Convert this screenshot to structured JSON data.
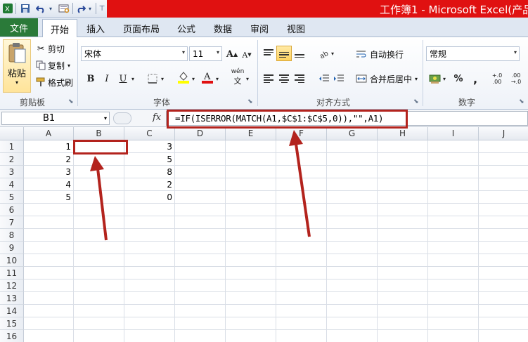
{
  "window": {
    "title": "工作簿1 - Microsoft Excel(产品",
    "quick_access": [
      "excel-logo-icon",
      "save-icon",
      "undo-icon",
      "print-preview-icon",
      "redo-icon",
      "customize-icon"
    ]
  },
  "tabs": {
    "file": "文件",
    "items": [
      "开始",
      "插入",
      "页面布局",
      "公式",
      "数据",
      "审阅",
      "视图"
    ],
    "active": "开始"
  },
  "ribbon": {
    "clipboard": {
      "paste": "粘贴",
      "cut": "剪切",
      "copy": "复制",
      "format_painter": "格式刷",
      "label": "剪贴板"
    },
    "font": {
      "name": "宋体",
      "size": "11",
      "bold": "B",
      "italic": "I",
      "underline": "U",
      "grow": "A",
      "shrink": "A",
      "wen": "wén",
      "label": "字体"
    },
    "alignment": {
      "wrap": "自动换行",
      "merge": "合并后居中",
      "label": "对齐方式"
    },
    "number": {
      "format": "常规",
      "percent": "%",
      "comma": ",",
      "inc": "+.0 .00",
      "dec": ".00 →.0",
      "label": "数字"
    }
  },
  "formula_bar": {
    "name_box": "B1",
    "fx": "fx",
    "formula": "=IF(ISERROR(MATCH(A1,$C$1:$C$5,0)),\"\",A1)"
  },
  "sheet": {
    "columns": [
      "A",
      "B",
      "C",
      "D",
      "E",
      "F",
      "G",
      "H",
      "I",
      "J"
    ],
    "rows": [
      "1",
      "2",
      "3",
      "4",
      "5",
      "6",
      "7",
      "8",
      "9",
      "10",
      "11",
      "12",
      "13",
      "14",
      "15",
      "16"
    ],
    "col_a": [
      "1",
      "2",
      "3",
      "4",
      "5"
    ],
    "col_c": [
      "3",
      "5",
      "8",
      "2",
      "0"
    ]
  },
  "colors": {
    "accent_red": "#e01111",
    "file_tab": "#2a7a39",
    "annotation": "#b3231d"
  }
}
